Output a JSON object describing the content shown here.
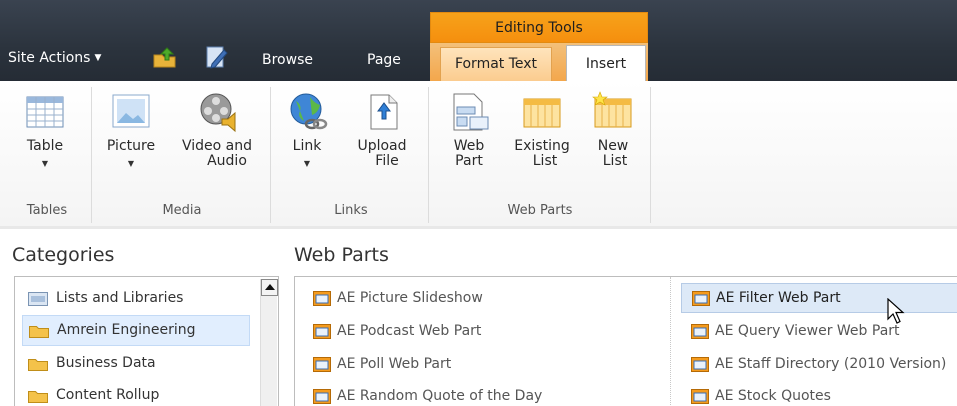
{
  "topbar": {
    "site_actions": "Site Actions",
    "tabs": {
      "browse": "Browse",
      "page": "Page"
    },
    "contextual_group": "Editing Tools",
    "contextual_tabs": {
      "format_text": "Format Text",
      "insert": "Insert"
    }
  },
  "ribbon": {
    "groups": {
      "tables": {
        "label": "Tables",
        "buttons": {
          "table": "Table"
        }
      },
      "media": {
        "label": "Media",
        "buttons": {
          "picture": "Picture",
          "video_line1": "Video and",
          "video_line2": "Audio"
        }
      },
      "links": {
        "label": "Links",
        "buttons": {
          "link": "Link",
          "upload_line1": "Upload",
          "upload_line2": "File"
        }
      },
      "web_parts": {
        "label": "Web Parts",
        "buttons": {
          "web_part_line1": "Web",
          "web_part_line2": "Part",
          "existing_line1": "Existing",
          "existing_line2": "List",
          "new_line1": "New",
          "new_line2": "List"
        }
      }
    }
  },
  "panels": {
    "categories_title": "Categories",
    "webparts_title": "Web Parts",
    "categories": [
      "Lists and Libraries",
      "Amrein Engineering",
      "Business Data",
      "Content Rollup"
    ],
    "webparts_col1": [
      "AE Picture Slideshow",
      "AE Podcast Web Part",
      "AE Poll Web Part",
      "AE Random Quote of the Day"
    ],
    "webparts_col2": [
      "AE Filter Web Part",
      "AE Query Viewer Web Part",
      "AE Staff Directory (2010 Version)",
      "AE Stock Quotes"
    ]
  },
  "colors": {
    "accent_orange": "#f58f0e",
    "topbar": "#2b333d",
    "selection": "#e1eefe"
  }
}
